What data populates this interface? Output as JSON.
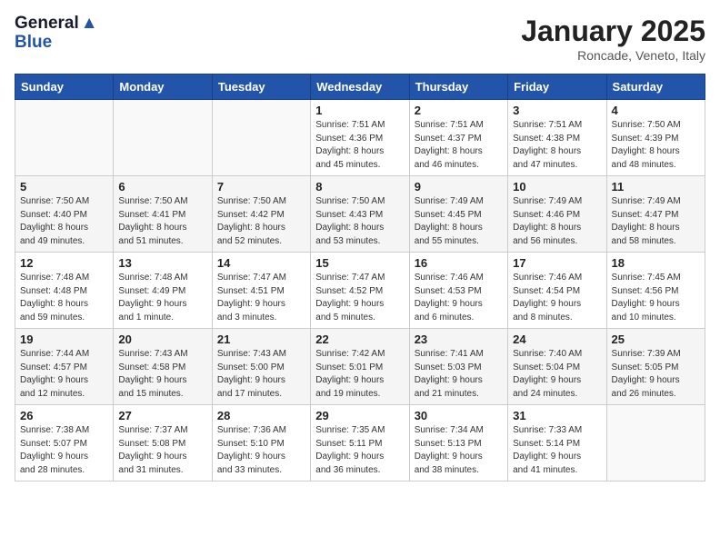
{
  "header": {
    "logo_general": "General",
    "logo_blue": "Blue",
    "month": "January 2025",
    "location": "Roncade, Veneto, Italy"
  },
  "days_of_week": [
    "Sunday",
    "Monday",
    "Tuesday",
    "Wednesday",
    "Thursday",
    "Friday",
    "Saturday"
  ],
  "weeks": [
    [
      {
        "day": "",
        "info": ""
      },
      {
        "day": "",
        "info": ""
      },
      {
        "day": "",
        "info": ""
      },
      {
        "day": "1",
        "info": "Sunrise: 7:51 AM\nSunset: 4:36 PM\nDaylight: 8 hours\nand 45 minutes."
      },
      {
        "day": "2",
        "info": "Sunrise: 7:51 AM\nSunset: 4:37 PM\nDaylight: 8 hours\nand 46 minutes."
      },
      {
        "day": "3",
        "info": "Sunrise: 7:51 AM\nSunset: 4:38 PM\nDaylight: 8 hours\nand 47 minutes."
      },
      {
        "day": "4",
        "info": "Sunrise: 7:50 AM\nSunset: 4:39 PM\nDaylight: 8 hours\nand 48 minutes."
      }
    ],
    [
      {
        "day": "5",
        "info": "Sunrise: 7:50 AM\nSunset: 4:40 PM\nDaylight: 8 hours\nand 49 minutes."
      },
      {
        "day": "6",
        "info": "Sunrise: 7:50 AM\nSunset: 4:41 PM\nDaylight: 8 hours\nand 51 minutes."
      },
      {
        "day": "7",
        "info": "Sunrise: 7:50 AM\nSunset: 4:42 PM\nDaylight: 8 hours\nand 52 minutes."
      },
      {
        "day": "8",
        "info": "Sunrise: 7:50 AM\nSunset: 4:43 PM\nDaylight: 8 hours\nand 53 minutes."
      },
      {
        "day": "9",
        "info": "Sunrise: 7:49 AM\nSunset: 4:45 PM\nDaylight: 8 hours\nand 55 minutes."
      },
      {
        "day": "10",
        "info": "Sunrise: 7:49 AM\nSunset: 4:46 PM\nDaylight: 8 hours\nand 56 minutes."
      },
      {
        "day": "11",
        "info": "Sunrise: 7:49 AM\nSunset: 4:47 PM\nDaylight: 8 hours\nand 58 minutes."
      }
    ],
    [
      {
        "day": "12",
        "info": "Sunrise: 7:48 AM\nSunset: 4:48 PM\nDaylight: 8 hours\nand 59 minutes."
      },
      {
        "day": "13",
        "info": "Sunrise: 7:48 AM\nSunset: 4:49 PM\nDaylight: 9 hours\nand 1 minute."
      },
      {
        "day": "14",
        "info": "Sunrise: 7:47 AM\nSunset: 4:51 PM\nDaylight: 9 hours\nand 3 minutes."
      },
      {
        "day": "15",
        "info": "Sunrise: 7:47 AM\nSunset: 4:52 PM\nDaylight: 9 hours\nand 5 minutes."
      },
      {
        "day": "16",
        "info": "Sunrise: 7:46 AM\nSunset: 4:53 PM\nDaylight: 9 hours\nand 6 minutes."
      },
      {
        "day": "17",
        "info": "Sunrise: 7:46 AM\nSunset: 4:54 PM\nDaylight: 9 hours\nand 8 minutes."
      },
      {
        "day": "18",
        "info": "Sunrise: 7:45 AM\nSunset: 4:56 PM\nDaylight: 9 hours\nand 10 minutes."
      }
    ],
    [
      {
        "day": "19",
        "info": "Sunrise: 7:44 AM\nSunset: 4:57 PM\nDaylight: 9 hours\nand 12 minutes."
      },
      {
        "day": "20",
        "info": "Sunrise: 7:43 AM\nSunset: 4:58 PM\nDaylight: 9 hours\nand 15 minutes."
      },
      {
        "day": "21",
        "info": "Sunrise: 7:43 AM\nSunset: 5:00 PM\nDaylight: 9 hours\nand 17 minutes."
      },
      {
        "day": "22",
        "info": "Sunrise: 7:42 AM\nSunset: 5:01 PM\nDaylight: 9 hours\nand 19 minutes."
      },
      {
        "day": "23",
        "info": "Sunrise: 7:41 AM\nSunset: 5:03 PM\nDaylight: 9 hours\nand 21 minutes."
      },
      {
        "day": "24",
        "info": "Sunrise: 7:40 AM\nSunset: 5:04 PM\nDaylight: 9 hours\nand 24 minutes."
      },
      {
        "day": "25",
        "info": "Sunrise: 7:39 AM\nSunset: 5:05 PM\nDaylight: 9 hours\nand 26 minutes."
      }
    ],
    [
      {
        "day": "26",
        "info": "Sunrise: 7:38 AM\nSunset: 5:07 PM\nDaylight: 9 hours\nand 28 minutes."
      },
      {
        "day": "27",
        "info": "Sunrise: 7:37 AM\nSunset: 5:08 PM\nDaylight: 9 hours\nand 31 minutes."
      },
      {
        "day": "28",
        "info": "Sunrise: 7:36 AM\nSunset: 5:10 PM\nDaylight: 9 hours\nand 33 minutes."
      },
      {
        "day": "29",
        "info": "Sunrise: 7:35 AM\nSunset: 5:11 PM\nDaylight: 9 hours\nand 36 minutes."
      },
      {
        "day": "30",
        "info": "Sunrise: 7:34 AM\nSunset: 5:13 PM\nDaylight: 9 hours\nand 38 minutes."
      },
      {
        "day": "31",
        "info": "Sunrise: 7:33 AM\nSunset: 5:14 PM\nDaylight: 9 hours\nand 41 minutes."
      },
      {
        "day": "",
        "info": ""
      }
    ]
  ]
}
